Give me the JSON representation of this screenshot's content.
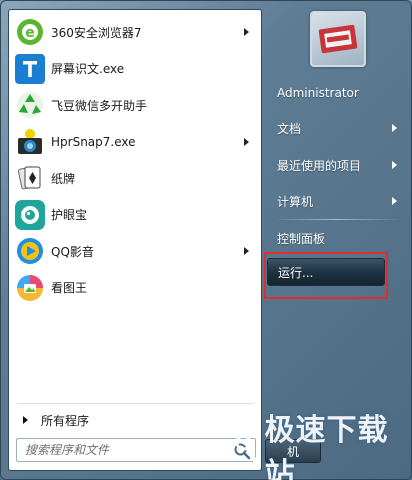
{
  "programs": [
    {
      "label": "360安全浏览器7",
      "icon": "browser-360-icon",
      "has_submenu": true,
      "color": "#5cb531"
    },
    {
      "label": "屏幕识文.exe",
      "icon": "text-recognition-icon",
      "has_submenu": false,
      "color": "#1a7fd1"
    },
    {
      "label": "飞豆微信多开助手",
      "icon": "recycle-icon",
      "has_submenu": false,
      "color": "#2da33c"
    },
    {
      "label": "HprSnap7.exe",
      "icon": "camera-icon",
      "has_submenu": true,
      "color": "#2a86c7"
    },
    {
      "label": "纸牌",
      "icon": "cards-icon",
      "has_submenu": false,
      "color": "#444444"
    },
    {
      "label": "护眼宝",
      "icon": "eye-icon",
      "has_submenu": false,
      "color": "#1fa59a"
    },
    {
      "label": "QQ影音",
      "icon": "qq-player-icon",
      "has_submenu": true,
      "color": "#1f8fe0"
    },
    {
      "label": "看图王",
      "icon": "image-viewer-icon",
      "has_submenu": false,
      "color": "#e64a6e"
    }
  ],
  "all_programs": "所有程序",
  "search": {
    "placeholder": "搜索程序和文件"
  },
  "right": {
    "user": "Administrator",
    "documents": "文档",
    "recent": "最近使用的项目",
    "computer": "计算机",
    "control_panel": "控制面板",
    "run": "运行...",
    "shutdown_fragment": "机"
  },
  "watermark": {
    "text": "极速下载站"
  },
  "colors": {
    "highlight": "#e12d2d"
  }
}
